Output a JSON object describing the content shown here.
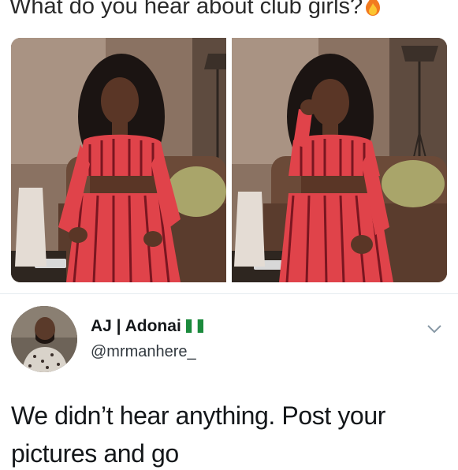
{
  "meme": {
    "caption": "What do you hear about club girls?",
    "caption_emoji": "fire-icon"
  },
  "photos": [
    {
      "icon": "photo-woman-red-outfit"
    },
    {
      "icon": "photo-woman-red-outfit"
    }
  ],
  "tweet": {
    "display_name": "AJ | Adonai",
    "flag_icon": "nigeria-flag-icon",
    "handle": "@mrmanhere_",
    "text": "We didn’t hear anything. Post your pictures and go"
  },
  "colors": {
    "outfit_red": "#e0434a",
    "stripe_dark": "#7a1620",
    "sofa_brown": "#6b4a38",
    "cushion_green": "#a9a56a",
    "flag_green": "#1b8a3c"
  }
}
